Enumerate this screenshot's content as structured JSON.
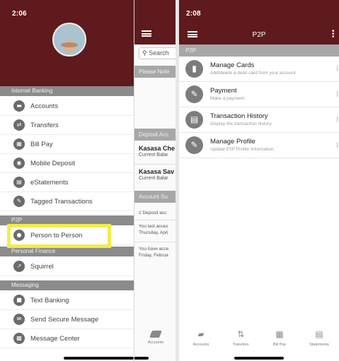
{
  "left_phone": {
    "status_time": "2:06",
    "sections": {
      "internet_banking": "Internet Banking",
      "p2p": "P2P",
      "personal_finance": "Personal Finance",
      "messaging": "Messaging"
    },
    "menu": {
      "accounts": "Accounts",
      "transfers": "Transfers",
      "bill_pay": "Bill Pay",
      "mobile_deposit": "Mobile Deposit",
      "estatements": "eStatements",
      "tagged_transactions": "Tagged Transactions",
      "person_to_person": "Person to Person",
      "squirrel": "Squirrel",
      "text_banking": "Text Banking",
      "send_secure_message": "Send Secure Message",
      "message_center": "Message Center"
    },
    "background_page": {
      "search_placeholder": "Search",
      "notice_label": "Please Note",
      "deposit_section": "Deposit Acc",
      "account_1_name": "Kasasa Che",
      "account_1_balance": "Current Balar",
      "account_2_name": "Kasasa Sav",
      "account_2_balance": "Current Balar",
      "summary_section": "Account Su",
      "summary_1": "2 Deposit acc",
      "summary_2_line1": "You last acces",
      "summary_2_line2": "Thursday, Apri",
      "summary_3_line1": "You have acce",
      "summary_3_line2": "Friday, Februa",
      "tab_accounts": "Accounts"
    },
    "highlighted_item": "person_to_person"
  },
  "right_phone": {
    "status_time": "2:08",
    "title": "P2P",
    "section": "P2P",
    "items": [
      {
        "title": "Manage Cards",
        "subtitle": "Add/delete a debit card from your account.",
        "icon": "card-icon"
      },
      {
        "title": "Payment",
        "subtitle": "Make a payment.",
        "icon": "pencil-icon"
      },
      {
        "title": "Transaction History",
        "subtitle": "Display the transaction history.",
        "icon": "document-icon"
      },
      {
        "title": "Manage Profile",
        "subtitle": "Update P2P Profile Information.",
        "icon": "pencil-icon"
      }
    ],
    "tabs": {
      "accounts": "Accounts",
      "transfers": "Transfers",
      "bill_pay": "Bill Pay",
      "statements": "Statements"
    }
  },
  "colors": {
    "brand": "#5e1a1c",
    "section_gray": "#8b8b8b",
    "highlight": "#f2ec4a"
  }
}
